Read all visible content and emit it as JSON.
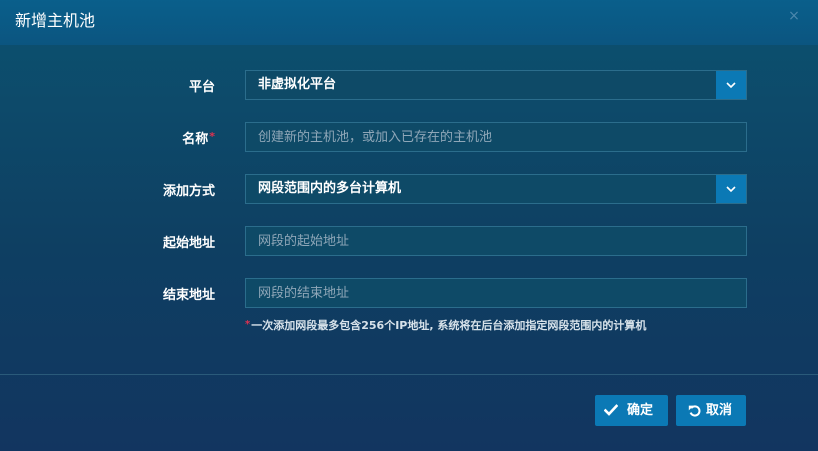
{
  "dialog": {
    "title": "新增主机池",
    "close_glyph": "×"
  },
  "form": {
    "platform": {
      "label": "平台",
      "value": "非虚拟化平台"
    },
    "name": {
      "label": "名称",
      "required_mark": "*",
      "value": "",
      "placeholder": "创建新的主机池，或加入已存在的主机池"
    },
    "add_method": {
      "label": "添加方式",
      "value": "网段范围内的多台计算机"
    },
    "start_address": {
      "label": "起始地址",
      "value": "",
      "placeholder": "网段的起始地址"
    },
    "end_address": {
      "label": "结束地址",
      "value": "",
      "placeholder": "网段的结束地址"
    },
    "hint": {
      "mark": "*",
      "text": "一次添加网段最多包含256个IP地址, 系统将在后台添加指定网段范围内的计算机"
    }
  },
  "footer": {
    "confirm_label": "确定",
    "cancel_label": "取消"
  },
  "colors": {
    "accent": "#0b79b5",
    "required": "#e0314f",
    "titlebar": "#0a5f8b"
  },
  "icons": {
    "dropdown": "chevron-down-icon",
    "confirm": "check-icon",
    "cancel": "undo-icon",
    "close": "close-icon"
  }
}
